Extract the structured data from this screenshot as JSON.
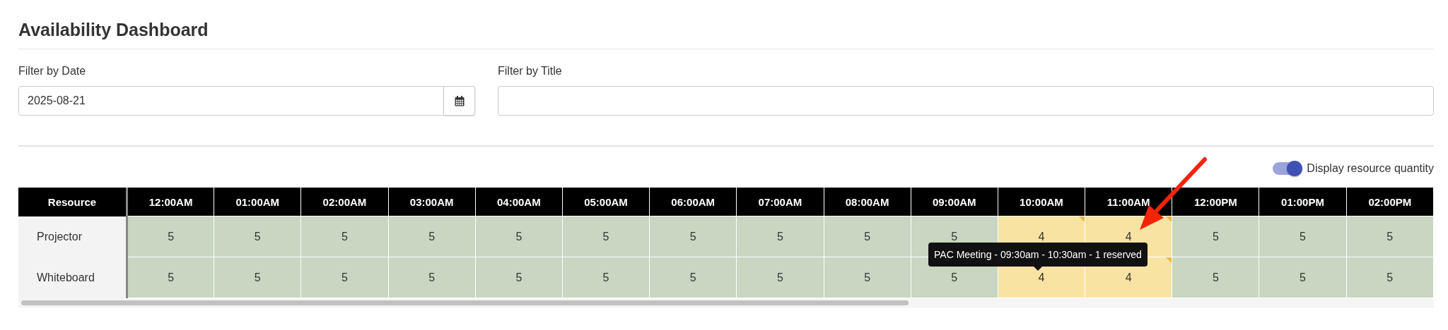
{
  "title": "Availability Dashboard",
  "filters": {
    "date": {
      "label": "Filter by Date",
      "value": "2025-08-21"
    },
    "title": {
      "label": "Filter by Title"
    }
  },
  "toggle": {
    "label": "Display resource quantity",
    "on": true
  },
  "table": {
    "corner": "Resource",
    "hours": [
      "12:00AM",
      "01:00AM",
      "02:00AM",
      "03:00AM",
      "04:00AM",
      "05:00AM",
      "06:00AM",
      "07:00AM",
      "08:00AM",
      "09:00AM",
      "10:00AM",
      "11:00AM",
      "12:00PM",
      "01:00PM",
      "02:00PM"
    ],
    "rows": [
      {
        "resource": "Projector",
        "cells": [
          {
            "value": "5",
            "booked": false
          },
          {
            "value": "5",
            "booked": false
          },
          {
            "value": "5",
            "booked": false
          },
          {
            "value": "5",
            "booked": false
          },
          {
            "value": "5",
            "booked": false
          },
          {
            "value": "5",
            "booked": false
          },
          {
            "value": "5",
            "booked": false
          },
          {
            "value": "5",
            "booked": false
          },
          {
            "value": "5",
            "booked": false
          },
          {
            "value": "5",
            "booked": false
          },
          {
            "value": "4",
            "booked": true
          },
          {
            "value": "4",
            "booked": true
          },
          {
            "value": "5",
            "booked": false
          },
          {
            "value": "5",
            "booked": false
          },
          {
            "value": "5",
            "booked": false
          }
        ]
      },
      {
        "resource": "Whiteboard",
        "cells": [
          {
            "value": "5",
            "booked": false
          },
          {
            "value": "5",
            "booked": false
          },
          {
            "value": "5",
            "booked": false
          },
          {
            "value": "5",
            "booked": false
          },
          {
            "value": "5",
            "booked": false
          },
          {
            "value": "5",
            "booked": false
          },
          {
            "value": "5",
            "booked": false
          },
          {
            "value": "5",
            "booked": false
          },
          {
            "value": "5",
            "booked": false
          },
          {
            "value": "5",
            "booked": false
          },
          {
            "value": "4",
            "booked": true
          },
          {
            "value": "4",
            "booked": true
          },
          {
            "value": "5",
            "booked": false
          },
          {
            "value": "5",
            "booked": false
          },
          {
            "value": "5",
            "booked": false
          }
        ]
      }
    ]
  },
  "tooltip": "PAC Meeting - 09:30am - 10:30am - 1 reserved"
}
